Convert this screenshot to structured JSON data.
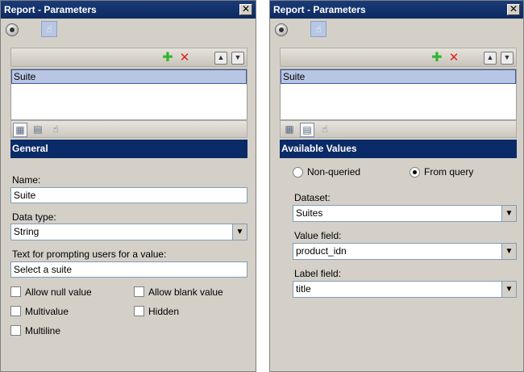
{
  "left_panel": {
    "title": "Report - Parameters",
    "close_glyph": "✕",
    "list": {
      "items": [
        "Suite"
      ]
    },
    "section": "General",
    "name_label": "Name:",
    "name_value": "Suite",
    "datatype_label": "Data type:",
    "datatype_value": "String",
    "prompt_label": "Text for prompting users for a value:",
    "prompt_value": "Select a suite",
    "checkboxes": {
      "allow_null": "Allow null value",
      "allow_blank": "Allow blank value",
      "multivalue": "Multivalue",
      "hidden": "Hidden",
      "multiline": "Multiline"
    }
  },
  "right_panel": {
    "title": "Report - Parameters",
    "close_glyph": "✕",
    "list": {
      "items": [
        "Suite"
      ]
    },
    "section": "Available Values",
    "radio_nonqueried": "Non-queried",
    "radio_fromquery": "From query",
    "dataset_label": "Dataset:",
    "dataset_value": "Suites",
    "valuefield_label": "Value field:",
    "valuefield_value": "product_idn",
    "labelfield_label": "Label field:",
    "labelfield_value": "title"
  },
  "icons": {
    "back": "back-circle-icon",
    "hand": "hand-icon",
    "add": "✚",
    "delete": "✕",
    "up": "▲",
    "down": "▼",
    "combo": "▼",
    "general_tab": "▦",
    "values_tab": "▤",
    "default_tab": "☝"
  },
  "colors": {
    "titlebar": "#0e2a60",
    "section_header": "#0b2a68",
    "selection": "#b9c6e3",
    "panel_bg": "#d4d0c8"
  }
}
